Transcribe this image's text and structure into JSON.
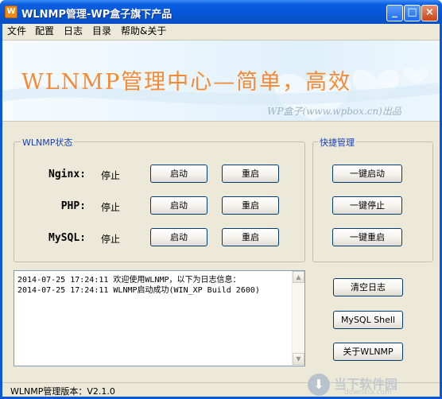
{
  "window": {
    "title": "WLNMP管理-WP盒子旗下产品",
    "app_icon_letter": "W",
    "minimize": "_",
    "maximize": "□",
    "close": "×"
  },
  "menu": [
    "文件",
    "配置",
    "日志",
    "目录",
    "帮助&关于"
  ],
  "banner": {
    "title": "WLNMP管理中心—简单，高效",
    "subtitle": "WP盒子(www.wpbox.cn)出品"
  },
  "status_group": {
    "label": "WLNMP状态",
    "services": [
      {
        "name": "Nginx:",
        "state": "停止",
        "start": "启动",
        "restart": "重启"
      },
      {
        "name": "PHP:",
        "state": "停止",
        "start": "启动",
        "restart": "重启"
      },
      {
        "name": "MySQL:",
        "state": "停止",
        "start": "启动",
        "restart": "重启"
      }
    ]
  },
  "quick_group": {
    "label": "快捷管理",
    "buttons": [
      "一键启动",
      "一键停止",
      "一键重启"
    ]
  },
  "log": {
    "lines": [
      "2014-07-25 17:24:11  欢迎使用WLNMP，以下为日志信息：",
      "2014-07-25 17:24:11  WLNMP启动成功(WIN_XP Build 2600)"
    ]
  },
  "side_buttons": {
    "clear_log": "清空日志",
    "mysql_shell": "MySQL Shell",
    "about": "关于WLNMP"
  },
  "statusbar": {
    "version": "WLNMP管理版本：V2.1.0"
  },
  "watermark": {
    "main": "当下软件园",
    "sub": "downxia.com"
  },
  "colors": {
    "titlebar": "#0656d6",
    "banner_title": "#f58a35",
    "group_label": "#1a3fb5",
    "client_bg": "#ece9d8"
  }
}
